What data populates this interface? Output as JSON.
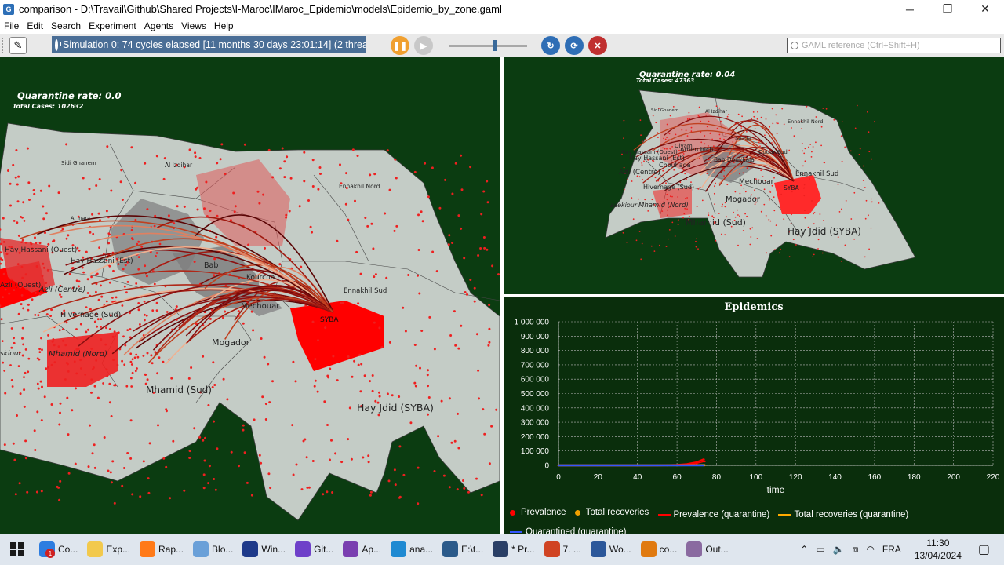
{
  "window": {
    "title": "comparison - D:\\Travail\\Github\\Shared Projects\\I-Maroc\\IMaroc_Epidemio\\models\\Epidemio_by_zone.gaml",
    "controls": {
      "minimize": "─",
      "restore": "❐",
      "close": "✕"
    }
  },
  "menu": [
    "File",
    "Edit",
    "Search",
    "Experiment",
    "Agents",
    "Views",
    "Help"
  ],
  "toolbar": {
    "status": "Simulation 0: 74 cycles elapsed [11 months 30 days 23:01:14] (2 thread",
    "search_placeholder": "GAML reference (Ctrl+Shift+H)",
    "buttons": [
      "pause",
      "step",
      "reload",
      "relaunch",
      "close"
    ]
  },
  "left_view": {
    "title": "Quarantine rate: 0.0",
    "subtitle": "Total Cases: 102632",
    "labels": [
      "Sidi Ghanem",
      "Al Izdihar",
      "Ennakhil Nord",
      "Ennakhil Sud",
      "SYBA",
      "Mechouar",
      "Mogador",
      "Mhamid (Sud)",
      "Hay Jdid (SYBA)",
      "Hivernage (Sud)",
      "Mhamid (Nord)",
      "Azli (Centre)",
      "Azli (Ouest)",
      "Bab",
      "Kourcha",
      "Al Inara",
      "Hay Hassani (Est)",
      "skiour",
      "Hay Hassani (Ouest)"
    ]
  },
  "right_view": {
    "title": "Quarantine rate: 0.04",
    "subtitle": "Total Cases: 47363",
    "labels": [
      "Sidi Ghanem",
      "Al Izdihar",
      "Ennakhil Nord",
      "Ennakhil Sud",
      "SYBA",
      "Mechouar",
      "Mogador",
      "Mhamid (Sud)",
      "Hay Jdid (SYBA)",
      "Hivernage (Sud)",
      "Mhamid (Nord)",
      "Azli (Centre)",
      "Hay Hassani (Est)",
      "Hay Hassani (Ouest)",
      "Amerchich",
      "Douar Sud",
      "Saada",
      "Chouhada",
      "Bab Doukkala",
      "Qiyam",
      "asekiour"
    ]
  },
  "chart_data": {
    "type": "line",
    "title": "Epidemics",
    "xlabel": "time",
    "ylabel": "",
    "xlim": [
      0,
      220
    ],
    "ylim": [
      0,
      1000000
    ],
    "x_ticks": [
      "0",
      "20",
      "40",
      "60",
      "80",
      "100",
      "120",
      "140",
      "160",
      "180",
      "200",
      "220"
    ],
    "y_ticks": [
      "0",
      "100 000",
      "200 000",
      "300 000",
      "400 000",
      "500 000",
      "600 000",
      "700 000",
      "800 000",
      "900 000",
      "1 000 000"
    ],
    "grid": true,
    "legend_position": "bottom",
    "series": [
      {
        "name": "Prevalence",
        "style": "dot",
        "color": "#ff0000",
        "x": [
          0,
          10,
          20,
          30,
          40,
          50,
          55,
          60,
          65,
          70,
          74
        ],
        "y": [
          0,
          0,
          0,
          0,
          0,
          100,
          400,
          1500,
          5000,
          14000,
          28000
        ]
      },
      {
        "name": "Total recoveries",
        "style": "dot",
        "color": "#ff9900",
        "x": [
          0,
          20,
          40,
          60,
          74
        ],
        "y": [
          0,
          0,
          0,
          200,
          1200
        ]
      },
      {
        "name": "Prevalence (quarantine)",
        "style": "line",
        "color": "#ff0000",
        "x": [
          0,
          10,
          20,
          30,
          40,
          50,
          55,
          60,
          65,
          70,
          74
        ],
        "y": [
          0,
          0,
          0,
          0,
          0,
          200,
          900,
          3000,
          9000,
          22000,
          45000
        ]
      },
      {
        "name": "Total recoveries (quarantine)",
        "style": "line",
        "color": "#ffaa00",
        "x": [
          0,
          20,
          40,
          60,
          74
        ],
        "y": [
          0,
          0,
          0,
          300,
          2000
        ]
      },
      {
        "name": "Quarantined (quarantine)",
        "style": "line",
        "color": "#3355ff",
        "x": [
          0,
          20,
          40,
          60,
          74
        ],
        "y": [
          0,
          0,
          0,
          0,
          0
        ]
      }
    ]
  },
  "taskbar": {
    "items": [
      {
        "label": "Co...",
        "color": "#2d7de0"
      },
      {
        "label": "Exp...",
        "color": "#f2c94c"
      },
      {
        "label": "Rap...",
        "color": "#ff7a18"
      },
      {
        "label": "Blo...",
        "color": "#6aa0d8"
      },
      {
        "label": "Win...",
        "color": "#1e3a8a"
      },
      {
        "label": "Git...",
        "color": "#6e40c9"
      },
      {
        "label": "Ap...",
        "color": "#7a3fb0"
      },
      {
        "label": "ana...",
        "color": "#1f8ad2"
      },
      {
        "label": "E:\\t...",
        "color": "#2b5a8a"
      },
      {
        "label": "* Pr...",
        "color": "#2a3f66"
      },
      {
        "label": "7. ...",
        "color": "#d04423"
      },
      {
        "label": "Wo...",
        "color": "#2b579a"
      },
      {
        "label": "co...",
        "color": "#e07a10"
      },
      {
        "label": "Out...",
        "color": "#8a6aa0"
      }
    ],
    "badge": "1",
    "language": "FRA",
    "time": "11:30",
    "date": "13/04/2024"
  }
}
